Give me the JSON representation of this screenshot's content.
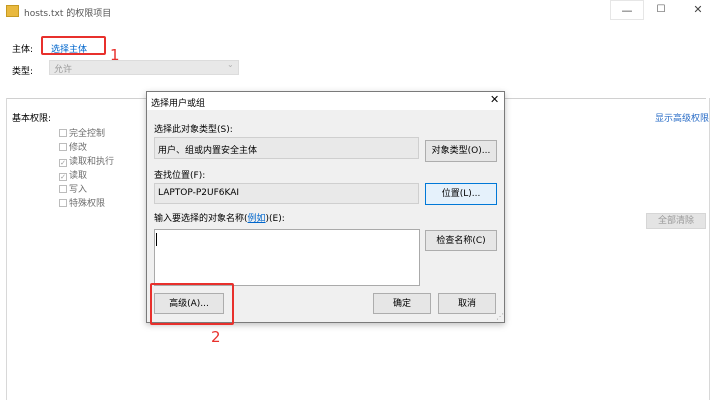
{
  "window": {
    "title": "hosts.txt 的权限项目",
    "min_glyph": "—",
    "max_glyph": "☐",
    "close_glyph": "✕"
  },
  "principal": {
    "label": "主体:",
    "link": "选择主体"
  },
  "type": {
    "label": "类型:",
    "value": "允许"
  },
  "permissions": {
    "heading": "基本权限:",
    "show_advanced": "显示高级权限",
    "items": [
      {
        "label": "完全控制",
        "checked": false
      },
      {
        "label": "修改",
        "checked": false
      },
      {
        "label": "读取和执行",
        "checked": true
      },
      {
        "label": "读取",
        "checked": true
      },
      {
        "label": "写入",
        "checked": false
      },
      {
        "label": "特殊权限",
        "checked": false
      }
    ],
    "clear_all": "全部清除"
  },
  "dialog": {
    "title": "选择用户或组",
    "close_glyph": "✕",
    "object_types_label": "选择此对象类型(S):",
    "object_types_value": "用户、组或内置安全主体",
    "object_types_button": "对象类型(O)...",
    "location_label": "查找位置(F):",
    "location_value": "LAPTOP-P2UF6KAI",
    "location_button": "位置(L)...",
    "enter_names_prefix": "输入要选择的对象名称(",
    "enter_names_example": "例如",
    "enter_names_suffix": ")(E):",
    "check_names_button": "检查名称(C)",
    "advanced_button": "高级(A)...",
    "ok_button": "确定",
    "cancel_button": "取消"
  },
  "annotations": {
    "one": "1",
    "two": "2",
    "color": "#e8302c"
  }
}
